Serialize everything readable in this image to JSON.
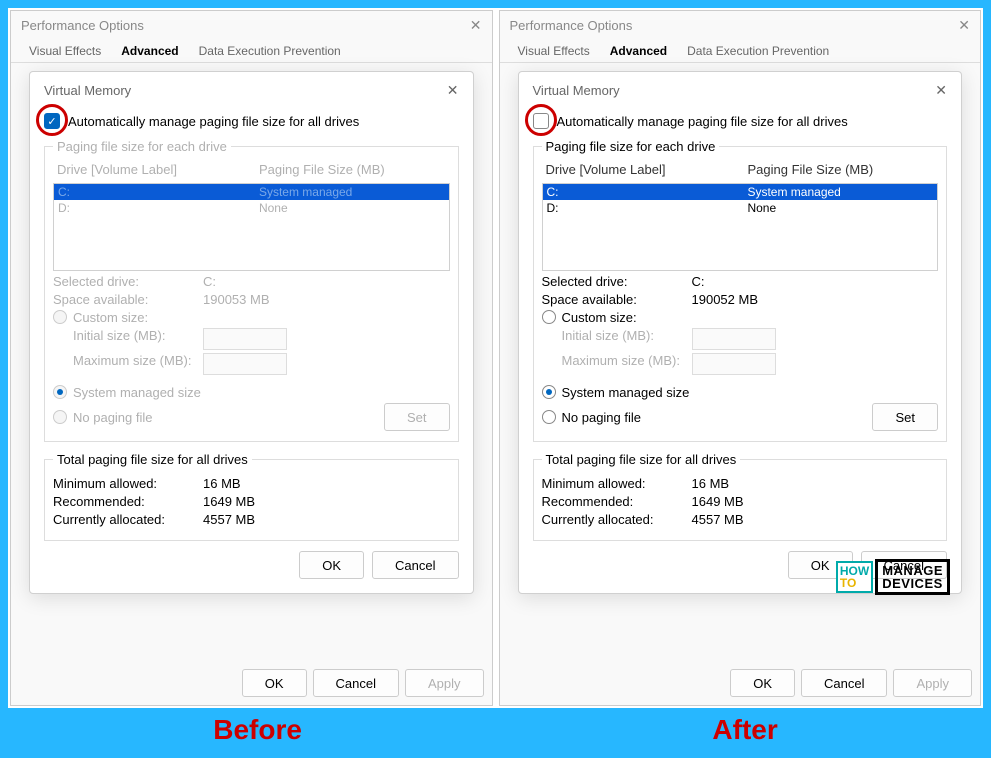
{
  "labels": {
    "before": "Before",
    "after": "After"
  },
  "logo": {
    "how": "HOW",
    "to": "TO",
    "manage": "MANAGE",
    "devices": "DEVICES"
  },
  "before": {
    "perfTitle": "Performance Options",
    "tabs": {
      "visual": "Visual Effects",
      "advanced": "Advanced",
      "dep": "Data Execution Prevention"
    },
    "vmTitle": "Virtual Memory",
    "autoCheckLabel": "Automatically manage paging file size for all drives",
    "autoChecked": true,
    "legend1": "Paging file size for each drive",
    "colDrive": "Drive  [Volume Label]",
    "colSize": "Paging File Size (MB)",
    "rowC_drive": "C:",
    "rowC_val": "System managed",
    "rowD_drive": "D:",
    "rowD_val": "None",
    "selDrive_k": "Selected drive:",
    "selDrive_v": "C:",
    "space_k": "Space available:",
    "space_v": "190053 MB",
    "custom": "Custom size:",
    "init": "Initial size (MB):",
    "max": "Maximum size (MB):",
    "sysman": "System managed size",
    "nopage": "No paging file",
    "set": "Set",
    "legend2": "Total paging file size for all drives",
    "min_k": "Minimum allowed:",
    "min_v": "16 MB",
    "rec_k": "Recommended:",
    "rec_v": "1649 MB",
    "cur_k": "Currently allocated:",
    "cur_v": "4557 MB",
    "ok": "OK",
    "cancel": "Cancel",
    "apply": "Apply"
  },
  "after": {
    "perfTitle": "Performance Options",
    "tabs": {
      "visual": "Visual Effects",
      "advanced": "Advanced",
      "dep": "Data Execution Prevention"
    },
    "vmTitle": "Virtual Memory",
    "autoCheckLabel": "Automatically manage paging file size for all drives",
    "autoChecked": false,
    "legend1": "Paging file size for each drive",
    "colDrive": "Drive  [Volume Label]",
    "colSize": "Paging File Size (MB)",
    "rowC_drive": "C:",
    "rowC_val": "System managed",
    "rowD_drive": "D:",
    "rowD_val": "None",
    "selDrive_k": "Selected drive:",
    "selDrive_v": "C:",
    "space_k": "Space available:",
    "space_v": "190052 MB",
    "custom": "Custom size:",
    "init": "Initial size (MB):",
    "max": "Maximum size (MB):",
    "sysman": "System managed size",
    "nopage": "No paging file",
    "set": "Set",
    "legend2": "Total paging file size for all drives",
    "min_k": "Minimum allowed:",
    "min_v": "16 MB",
    "rec_k": "Recommended:",
    "rec_v": "1649 MB",
    "cur_k": "Currently allocated:",
    "cur_v": "4557 MB",
    "ok": "OK",
    "cancel": "Cancel",
    "apply": "Apply"
  }
}
